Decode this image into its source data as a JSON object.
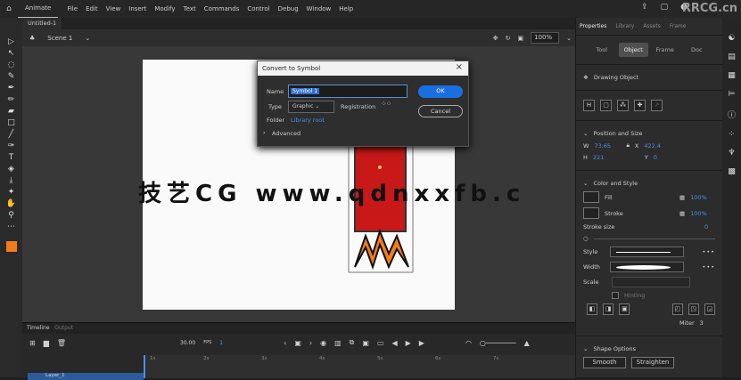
{
  "app": {
    "tab": "Animate",
    "menus": [
      "File",
      "Edit",
      "View",
      "Insert",
      "Modify",
      "Text",
      "Commands",
      "Control",
      "Debug",
      "Window",
      "Help"
    ],
    "watermark_logo": "RRCG.cn"
  },
  "document": {
    "tab": "Untitled-1",
    "scene": "Scene 1",
    "zoom": "100%"
  },
  "stage": {
    "watermark_text": "技艺CG  www.qdnxxfb.c",
    "shape_color": "#c81818",
    "accent_color": "#f07c1c"
  },
  "dialog": {
    "title": "Convert to Symbol",
    "name_label": "Name",
    "name_value": "Symbol 1",
    "type_label": "Type",
    "type_value": "Graphic",
    "registration_label": "Registration",
    "folder_label": "Folder",
    "folder_value": "Library root",
    "advanced_label": "Advanced",
    "ok": "OK",
    "cancel": "Cancel"
  },
  "properties": {
    "tabs": [
      "Properties",
      "Library",
      "Assets",
      "Frame"
    ],
    "segments": [
      "Tool",
      "Object",
      "Frame",
      "Doc"
    ],
    "object_type": "Drawing Object",
    "position_title": "Position and Size",
    "w_label": "W",
    "w_value": "73.65",
    "x_label": "X",
    "x_value": "422.4",
    "h_label": "H",
    "h_value": "221",
    "y_label": "Y",
    "y_value": "0",
    "color_title": "Color and Style",
    "fill_label": "Fill",
    "fill_pct": "100%",
    "stroke_label": "Stroke",
    "stroke_pct": "100%",
    "stroke_size_label": "Stroke size",
    "stroke_size": "0",
    "style_label": "Style",
    "width_label": "Width",
    "scale_label": "Scale",
    "hinting_label": "Hinting",
    "miter_label": "Miter",
    "miter_value": "3",
    "shape_title": "Shape Options",
    "smooth": "Smooth",
    "straighten": "Straighten"
  },
  "timeline": {
    "tabs": [
      "Timeline",
      "Output"
    ],
    "fps": "30.00",
    "fps_unit": "FPS",
    "frame": "1",
    "layer": "Layer_1",
    "ruler_seconds": [
      "1s",
      "2s",
      "3s",
      "4s",
      "5s",
      "6s",
      "7s"
    ]
  }
}
